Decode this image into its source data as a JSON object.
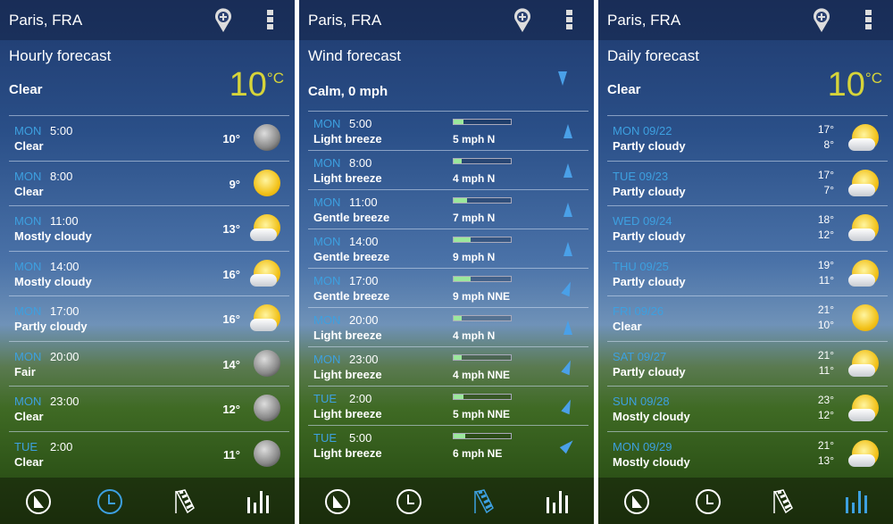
{
  "colors": {
    "accent": "#3da0e0",
    "temp": "#d6d43a",
    "wind_bar": "#9ce89c"
  },
  "panels": [
    {
      "city": "Paris, FRA",
      "title": "Hourly forecast",
      "condition": "Clear",
      "temp": "10",
      "unit": "°C",
      "active_tab": 1,
      "rows": [
        {
          "day": "MON",
          "time": "5:00",
          "desc": "Clear",
          "temp": "10°",
          "icon": "moon"
        },
        {
          "day": "MON",
          "time": "8:00",
          "desc": "Clear",
          "temp": "9°",
          "icon": "sun"
        },
        {
          "day": "MON",
          "time": "11:00",
          "desc": "Mostly cloudy",
          "temp": "13°",
          "icon": "partly-cloudy"
        },
        {
          "day": "MON",
          "time": "14:00",
          "desc": "Mostly cloudy",
          "temp": "16°",
          "icon": "partly-cloudy"
        },
        {
          "day": "MON",
          "time": "17:00",
          "desc": "Partly cloudy",
          "temp": "16°",
          "icon": "partly-cloudy"
        },
        {
          "day": "MON",
          "time": "20:00",
          "desc": "Fair",
          "temp": "14°",
          "icon": "moon"
        },
        {
          "day": "MON",
          "time": "23:00",
          "desc": "Clear",
          "temp": "12°",
          "icon": "moon"
        },
        {
          "day": "TUE",
          "time": "2:00",
          "desc": "Clear",
          "temp": "11°",
          "icon": "moon"
        }
      ]
    },
    {
      "city": "Paris, FRA",
      "title": "Wind forecast",
      "condition": "Calm, 0 mph",
      "active_tab": 2,
      "rows": [
        {
          "day": "MON",
          "time": "5:00",
          "desc": "Light breeze",
          "speed": "5 mph N",
          "mph": 5,
          "dir_deg": 0
        },
        {
          "day": "MON",
          "time": "8:00",
          "desc": "Light breeze",
          "speed": "4 mph N",
          "mph": 4,
          "dir_deg": 0
        },
        {
          "day": "MON",
          "time": "11:00",
          "desc": "Gentle breeze",
          "speed": "7 mph N",
          "mph": 7,
          "dir_deg": 0
        },
        {
          "day": "MON",
          "time": "14:00",
          "desc": "Gentle breeze",
          "speed": "9 mph N",
          "mph": 9,
          "dir_deg": 0
        },
        {
          "day": "MON",
          "time": "17:00",
          "desc": "Gentle breeze",
          "speed": "9 mph NNE",
          "mph": 9,
          "dir_deg": 22
        },
        {
          "day": "MON",
          "time": "20:00",
          "desc": "Light breeze",
          "speed": "4 mph N",
          "mph": 4,
          "dir_deg": 0
        },
        {
          "day": "MON",
          "time": "23:00",
          "desc": "Light breeze",
          "speed": "4 mph NNE",
          "mph": 4,
          "dir_deg": 22
        },
        {
          "day": "TUE",
          "time": "2:00",
          "desc": "Light breeze",
          "speed": "5 mph NNE",
          "mph": 5,
          "dir_deg": 22
        },
        {
          "day": "TUE",
          "time": "5:00",
          "desc": "Light breeze",
          "speed": "6 mph NE",
          "mph": 6,
          "dir_deg": 45
        }
      ]
    },
    {
      "city": "Paris, FRA",
      "title": "Daily forecast",
      "condition": "Clear",
      "temp": "10",
      "unit": "°C",
      "active_tab": 3,
      "rows": [
        {
          "day": "MON 09/22",
          "desc": "Partly cloudy",
          "hi": "17°",
          "lo": "8°",
          "icon": "partly-cloudy"
        },
        {
          "day": "TUE 09/23",
          "desc": "Partly cloudy",
          "hi": "17°",
          "lo": "7°",
          "icon": "partly-cloudy"
        },
        {
          "day": "WED 09/24",
          "desc": "Partly cloudy",
          "hi": "18°",
          "lo": "12°",
          "icon": "partly-cloudy"
        },
        {
          "day": "THU 09/25",
          "desc": "Partly cloudy",
          "hi": "19°",
          "lo": "11°",
          "icon": "partly-cloudy"
        },
        {
          "day": "FRI 09/26",
          "desc": "Clear",
          "hi": "21°",
          "lo": "10°",
          "icon": "sun"
        },
        {
          "day": "SAT 09/27",
          "desc": "Partly cloudy",
          "hi": "21°",
          "lo": "11°",
          "icon": "partly-cloudy"
        },
        {
          "day": "SUN 09/28",
          "desc": "Mostly cloudy",
          "hi": "23°",
          "lo": "12°",
          "icon": "partly-cloudy"
        },
        {
          "day": "MON 09/29",
          "desc": "Mostly cloudy",
          "hi": "21°",
          "lo": "13°",
          "icon": "partly-cloudy"
        }
      ]
    }
  ],
  "nav_tabs": [
    "current-conditions",
    "hourly-clock",
    "wind-sock",
    "daily-bars"
  ]
}
